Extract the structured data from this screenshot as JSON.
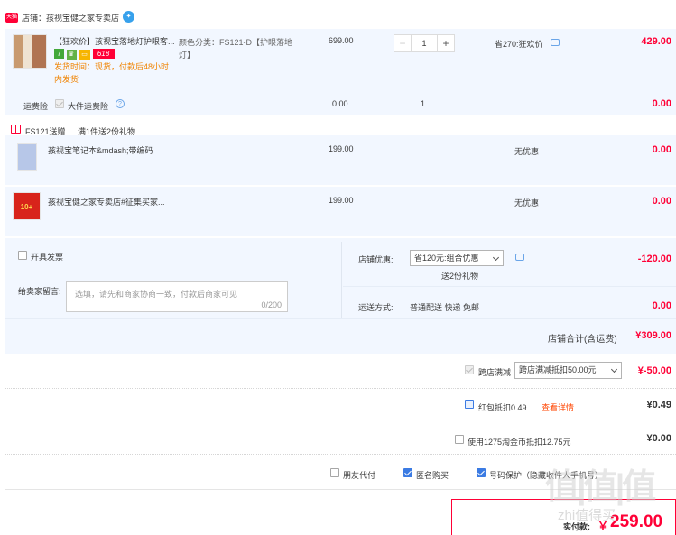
{
  "shop": {
    "tag": "天猫",
    "title": "店铺：孩视宝健之家专卖店"
  },
  "main_item": {
    "title": "【狂欢价】孩视宝落地灯护眼客...",
    "badges": [
      "7",
      "♛",
      "▭",
      "618"
    ],
    "ship_line1": "发货时间：现货，付款后48小时",
    "ship_line2": "内发货",
    "sku": "颜色分类：FS121-D【护眼落地灯】",
    "sku_line1": "颜色分类：FS121-D【护眼落地",
    "sku_line2": "灯】",
    "price": "699.00",
    "qty": "1",
    "minus": "−",
    "plus": "+",
    "saving": "省270:狂欢价",
    "total": "429.00"
  },
  "insurance": {
    "label": "运费险",
    "option": "大件运费险",
    "help": "?",
    "price": "0.00",
    "qty": "1",
    "total": "0.00"
  },
  "gift_header": {
    "name": "FS121送赠",
    "rule": "满1件送2份礼物"
  },
  "gifts": [
    {
      "title": "孩视宝笔记本&mdash;带编码",
      "price": "199.00",
      "discount": "无优惠",
      "total": "0.00"
    },
    {
      "title": "孩视宝健之家专卖店#征集买家...",
      "price": "199.00",
      "discount": "无优惠",
      "total": "0.00",
      "thumb_text": "10+"
    }
  ],
  "invoice": {
    "label": "开具发票"
  },
  "message": {
    "label": "给卖家留言:",
    "placeholder": "选填，请先和商家协商一致，付款后商家可见",
    "count": "0/200"
  },
  "shop_discount": {
    "label": "店铺优惠:",
    "selected": "省120元:组合优惠",
    "note": "送2份礼物",
    "value": "-120.00"
  },
  "shipping": {
    "label": "运送方式:",
    "method": "普通配送 快递 免邮",
    "value": "0.00"
  },
  "shop_total": {
    "label": "店铺合计(含运费)",
    "value": "¥309.00"
  },
  "cross_store": {
    "label": "跨店满减",
    "selected": "跨店满减抵扣50.00元",
    "value": "¥-50.00"
  },
  "red_packet": {
    "label": "红包抵扣0.49",
    "link": "查看详情",
    "value": "¥0.49"
  },
  "coins": {
    "label": "使用1275淘金币抵扣12.75元",
    "value": "¥0.00"
  },
  "options": {
    "friend_pay": "朋友代付",
    "anonymous": "匿名购买",
    "privacy": "号码保护（隐藏收件人手机号）"
  },
  "pay": {
    "label": "实付款:",
    "currency": "￥",
    "value": "259.00"
  },
  "watermark": {
    "big": "值|值|值",
    "small": "zhi值得买"
  },
  "colors": {
    "accent_red": "#ff0036",
    "row_blue": "#f2f7ff",
    "link_orange": "#f40",
    "check_blue": "#3b7be3"
  }
}
